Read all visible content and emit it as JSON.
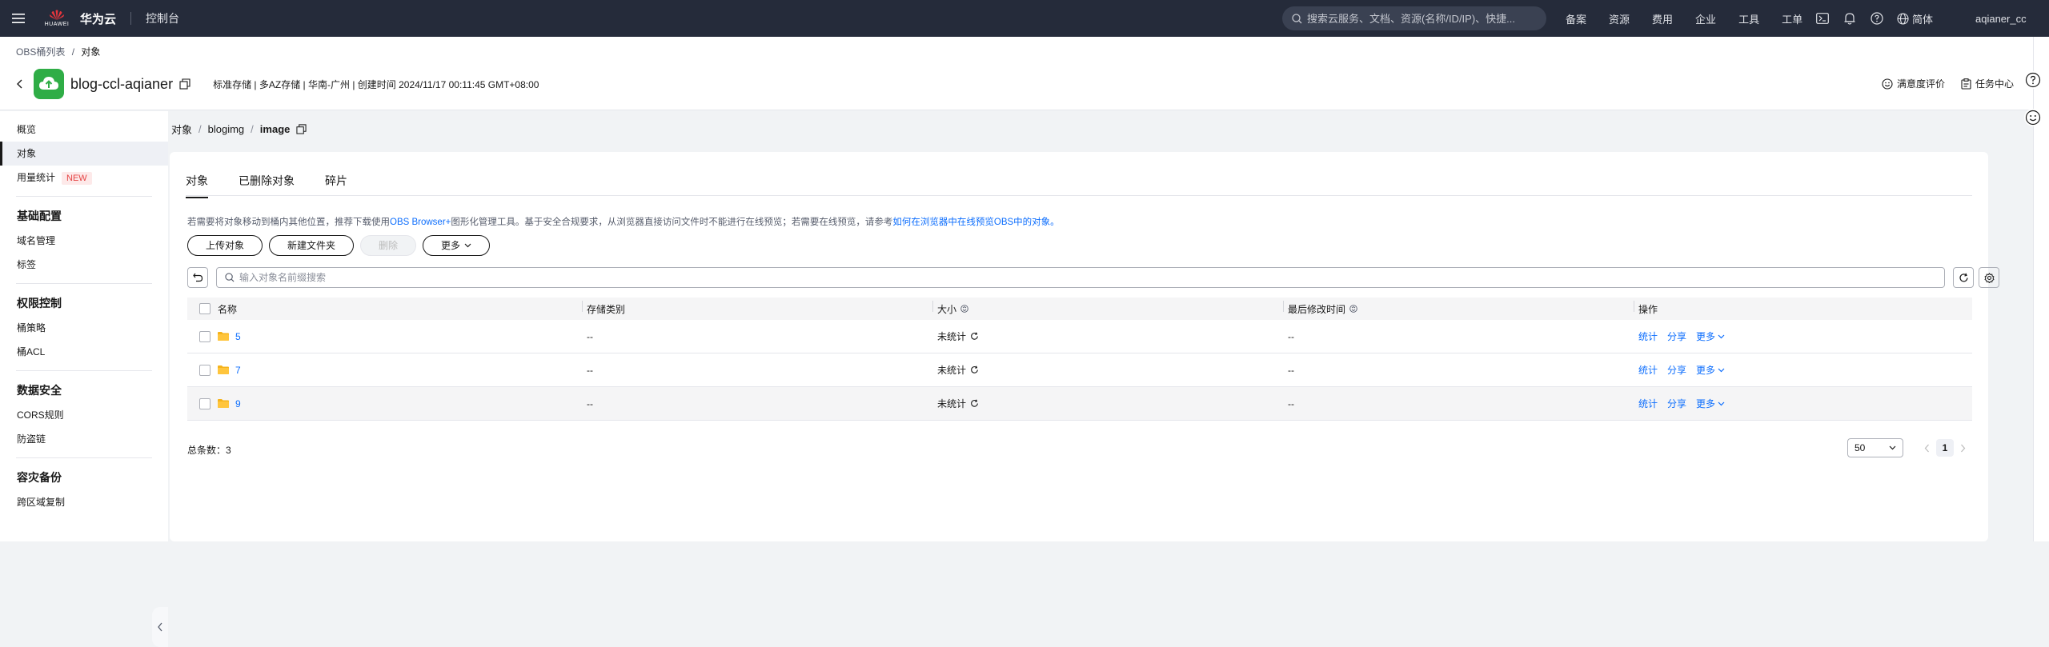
{
  "topbar": {
    "brand_small": "HUAWEI",
    "brand": "华为云",
    "console": "控制台",
    "search_placeholder": "搜索云服务、文档、资源(名称/ID/IP)、快捷...",
    "links": [
      "备案",
      "资源",
      "费用",
      "企业",
      "工具",
      "工单"
    ],
    "lang": "简体",
    "user": "aqianer_cc"
  },
  "header": {
    "breadcrumb_parent": "OBS桶列表",
    "breadcrumb_sep": "/",
    "breadcrumb_current": "对象",
    "bucket_name": "blog-ccl-aqianer",
    "bucket_meta": "标准存储 | 多AZ存储 | 华南-广州 | 创建时间  2024/11/17 00:11:45 GMT+08:00",
    "satisfaction": "满意度评价",
    "task_center": "任务中心"
  },
  "sidebar": {
    "items_top": [
      {
        "label": "概览",
        "active": false
      },
      {
        "label": "对象",
        "active": true
      },
      {
        "label": "用量统计",
        "badge": "NEW",
        "active": false
      }
    ],
    "groups": [
      {
        "title": "基础配置",
        "items": [
          "域名管理",
          "标签"
        ]
      },
      {
        "title": "权限控制",
        "items": [
          "桶策略",
          "桶ACL"
        ]
      },
      {
        "title": "数据安全",
        "items": [
          "CORS规则",
          "防盗链"
        ]
      },
      {
        "title": "容灾备份",
        "items": [
          "跨区域复制"
        ]
      }
    ]
  },
  "main": {
    "path": [
      "对象",
      "blogimg",
      "image"
    ],
    "tabs": [
      "对象",
      "已删除对象",
      "碎片"
    ],
    "notice_text": "若需要将对象移动到桶内其他位置，推荐下载使用",
    "notice_link1": "OBS Browser+",
    "notice_text2": "图形化管理工具。基于安全合规要求，从浏览器直接访问文件时不能进行在线预览；若需要在线预览，请参考",
    "notice_link2": "如何在浏览器中在线预览OBS中的对象。",
    "buttons": {
      "upload": "上传对象",
      "new_folder": "新建文件夹",
      "delete": "删除",
      "more": "更多"
    },
    "search_placeholder": "输入对象名前缀搜索",
    "columns": {
      "name": "名称",
      "storage": "存储类别",
      "size": "大小",
      "modified": "最后修改时间",
      "ops": "操作"
    },
    "rows": [
      {
        "name": "5",
        "storage": "--",
        "size": "未统计",
        "modified": "--"
      },
      {
        "name": "7",
        "storage": "--",
        "size": "未统计",
        "modified": "--"
      },
      {
        "name": "9",
        "storage": "--",
        "size": "未统计",
        "modified": "--"
      }
    ],
    "ops": {
      "stats": "统计",
      "share": "分享",
      "more": "更多"
    },
    "total": "总条数：3",
    "page_size": "50",
    "current_page": "1"
  },
  "colors": {
    "topbar": "#252b3a",
    "link": "#0d6efd",
    "bucket_icon": "#2fad46",
    "folder": "#f5b31b",
    "badge": "#e54545"
  }
}
